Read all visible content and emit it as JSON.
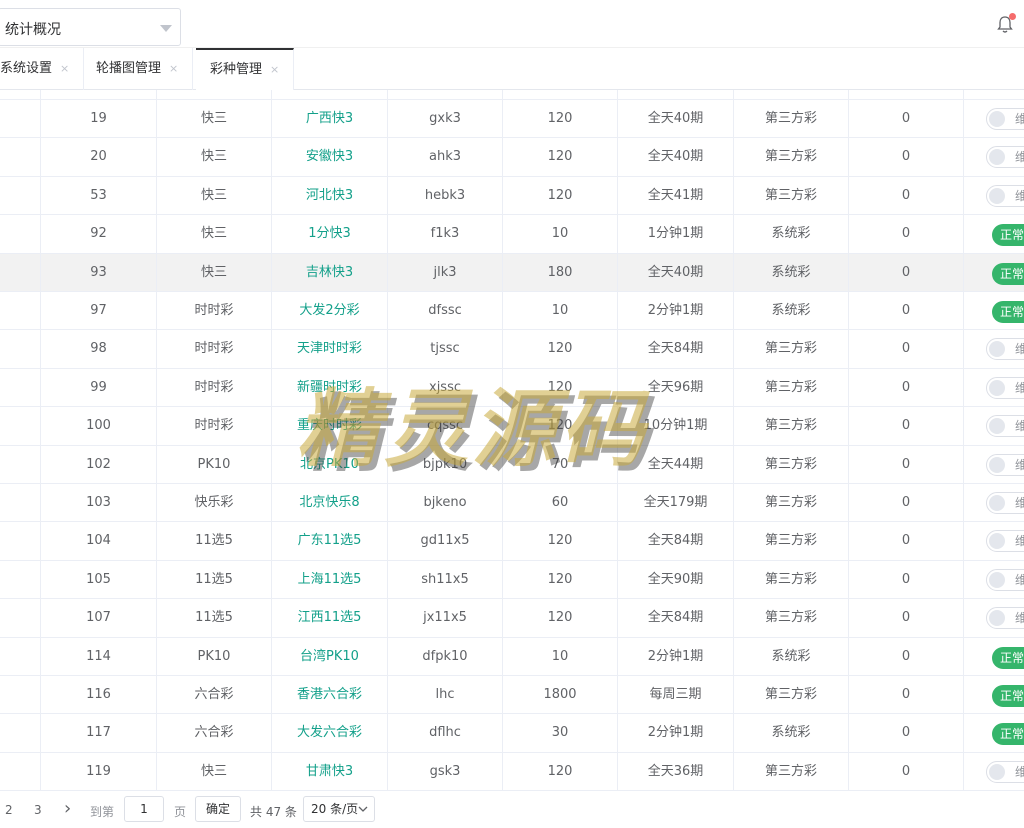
{
  "header": {
    "select_value": "统计概况",
    "bell_icon": "bell-icon"
  },
  "tabs": [
    {
      "label": "系统设置",
      "close": "×"
    },
    {
      "label": "轮播图管理",
      "close": "×"
    },
    {
      "label": "彩种管理",
      "close": "×"
    }
  ],
  "table": {
    "rows": [
      {
        "id": "19",
        "type": "快三",
        "name": "广西快3",
        "code": "gxk3",
        "seconds": "120",
        "periods": "全天40期",
        "source": "第三方彩",
        "sort": "0",
        "status": "维护"
      },
      {
        "id": "20",
        "type": "快三",
        "name": "安徽快3",
        "code": "ahk3",
        "seconds": "120",
        "periods": "全天40期",
        "source": "第三方彩",
        "sort": "0",
        "status": "维护"
      },
      {
        "id": "53",
        "type": "快三",
        "name": "河北快3",
        "code": "hebk3",
        "seconds": "120",
        "periods": "全天41期",
        "source": "第三方彩",
        "sort": "0",
        "status": "维护"
      },
      {
        "id": "92",
        "type": "快三",
        "name": "1分快3",
        "code": "f1k3",
        "seconds": "10",
        "periods": "1分钟1期",
        "source": "系统彩",
        "sort": "0",
        "status": "正常"
      },
      {
        "id": "93",
        "type": "快三",
        "name": "吉林快3",
        "code": "jlk3",
        "seconds": "180",
        "periods": "全天40期",
        "source": "系统彩",
        "sort": "0",
        "status": "正常"
      },
      {
        "id": "97",
        "type": "时时彩",
        "name": "大发2分彩",
        "code": "dfssc",
        "seconds": "10",
        "periods": "2分钟1期",
        "source": "系统彩",
        "sort": "0",
        "status": "正常"
      },
      {
        "id": "98",
        "type": "时时彩",
        "name": "天津时时彩",
        "code": "tjssc",
        "seconds": "120",
        "periods": "全天84期",
        "source": "第三方彩",
        "sort": "0",
        "status": "维护"
      },
      {
        "id": "99",
        "type": "时时彩",
        "name": "新疆时时彩",
        "code": "xjssc",
        "seconds": "120",
        "periods": "全天96期",
        "source": "第三方彩",
        "sort": "0",
        "status": "维护"
      },
      {
        "id": "100",
        "type": "时时彩",
        "name": "重庆时时彩",
        "code": "cqssc",
        "seconds": "120",
        "periods": "10分钟1期",
        "source": "第三方彩",
        "sort": "0",
        "status": "维护"
      },
      {
        "id": "102",
        "type": "PK10",
        "name": "北京PK10",
        "code": "bjpk10",
        "seconds": "70",
        "periods": "全天44期",
        "source": "第三方彩",
        "sort": "0",
        "status": "维护"
      },
      {
        "id": "103",
        "type": "快乐彩",
        "name": "北京快乐8",
        "code": "bjkeno",
        "seconds": "60",
        "periods": "全天179期",
        "source": "第三方彩",
        "sort": "0",
        "status": "维护"
      },
      {
        "id": "104",
        "type": "11选5",
        "name": "广东11选5",
        "code": "gd11x5",
        "seconds": "120",
        "periods": "全天84期",
        "source": "第三方彩",
        "sort": "0",
        "status": "维护"
      },
      {
        "id": "105",
        "type": "11选5",
        "name": "上海11选5",
        "code": "sh11x5",
        "seconds": "120",
        "periods": "全天90期",
        "source": "第三方彩",
        "sort": "0",
        "status": "维护"
      },
      {
        "id": "107",
        "type": "11选5",
        "name": "江西11选5",
        "code": "jx11x5",
        "seconds": "120",
        "periods": "全天84期",
        "source": "第三方彩",
        "sort": "0",
        "status": "维护"
      },
      {
        "id": "114",
        "type": "PK10",
        "name": "台湾PK10",
        "code": "dfpk10",
        "seconds": "10",
        "periods": "2分钟1期",
        "source": "系统彩",
        "sort": "0",
        "status": "正常"
      },
      {
        "id": "116",
        "type": "六合彩",
        "name": "香港六合彩",
        "code": "lhc",
        "seconds": "1800",
        "periods": "每周三期",
        "source": "第三方彩",
        "sort": "0",
        "status": "正常"
      },
      {
        "id": "117",
        "type": "六合彩",
        "name": "大发六合彩",
        "code": "dflhc",
        "seconds": "30",
        "periods": "2分钟1期",
        "source": "系统彩",
        "sort": "0",
        "status": "正常"
      },
      {
        "id": "119",
        "type": "快三",
        "name": "甘肃快3",
        "code": "gsk3",
        "seconds": "120",
        "periods": "全天36期",
        "source": "第三方彩",
        "sort": "0",
        "status": "维护"
      }
    ]
  },
  "watermark": "精灵源码",
  "pagination": {
    "page2": "2",
    "page3": "3",
    "next": "›",
    "goto_label": "到第",
    "goto_value": "1",
    "page_unit": "页",
    "confirm": "确定",
    "total": "共 47 条",
    "page_size": "20 条/页"
  },
  "colors": {
    "link": "#13a08a",
    "status_on": "#35b56b",
    "highlight_row": "#f2f2f2"
  }
}
